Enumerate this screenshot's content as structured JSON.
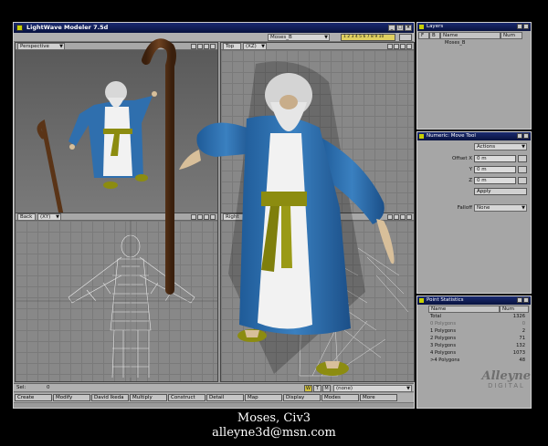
{
  "window": {
    "title": "LightWave Modeler 7.5d"
  },
  "top_bar": {
    "object_name": "Moses_B",
    "layer_count_label": "1 2 3 4 5 6 7 8 9 10"
  },
  "viewports": {
    "top_left": {
      "name": "Perspective",
      "option": ""
    },
    "top_right": {
      "name": "Top",
      "option": "(XZ)"
    },
    "bottom_left": {
      "name": "Back",
      "option": "(XY)"
    },
    "bottom_right": {
      "name": "Right",
      "option": ""
    }
  },
  "status_bar": {
    "sel_label": "Sel:",
    "sel_value": "0",
    "w_label": "W",
    "t_label": "T",
    "m_label": "M",
    "surface": "(none)"
  },
  "menu_tabs": [
    "Create",
    "Modify",
    "David Ikeda",
    "Multiply",
    "Construct",
    "Detail",
    "Map",
    "Display",
    "Modes",
    "More"
  ],
  "layers_panel": {
    "title": "Layers",
    "col_f": "F",
    "col_b": "B",
    "col_name": "Name",
    "col_num": "Num",
    "item": "Moses_B"
  },
  "numeric_panel": {
    "title": "Numeric: Move Tool",
    "actions": "Actions",
    "offset_label": "Offset X",
    "y_label": "Y",
    "z_label": "Z",
    "x_value": "0 m",
    "y_value": "0 m",
    "z_value": "0 m",
    "apply": "Apply",
    "falloff_label": "Falloff",
    "falloff_value": "None"
  },
  "stats_panel": {
    "title": "Point Statistics",
    "col_name": "Name",
    "col_num": "Num",
    "rows": [
      {
        "name": "Total",
        "num": "1326"
      },
      {
        "name": "0 Polygons",
        "num": "0"
      },
      {
        "name": "1 Polygons",
        "num": "2"
      },
      {
        "name": "2 Polygons",
        "num": "71"
      },
      {
        "name": "3 Polygons",
        "num": "132"
      },
      {
        "name": "4 Polygons",
        "num": "1073"
      },
      {
        "name": ">4 Polygons",
        "num": "48"
      }
    ]
  },
  "credit": {
    "line1": "Moses, Civ3",
    "line2": "alleyne3d@msn.com"
  },
  "logo": {
    "word": "Alleyne",
    "sub": "DIGITAL"
  },
  "colors": {
    "robe": "#2f6fae",
    "tunic": "#f2f2f2",
    "sash": "#8c8c10",
    "staff": "#5a3417",
    "title_bar": "#0d1a55",
    "ui_gray": "#9a9a9a"
  }
}
